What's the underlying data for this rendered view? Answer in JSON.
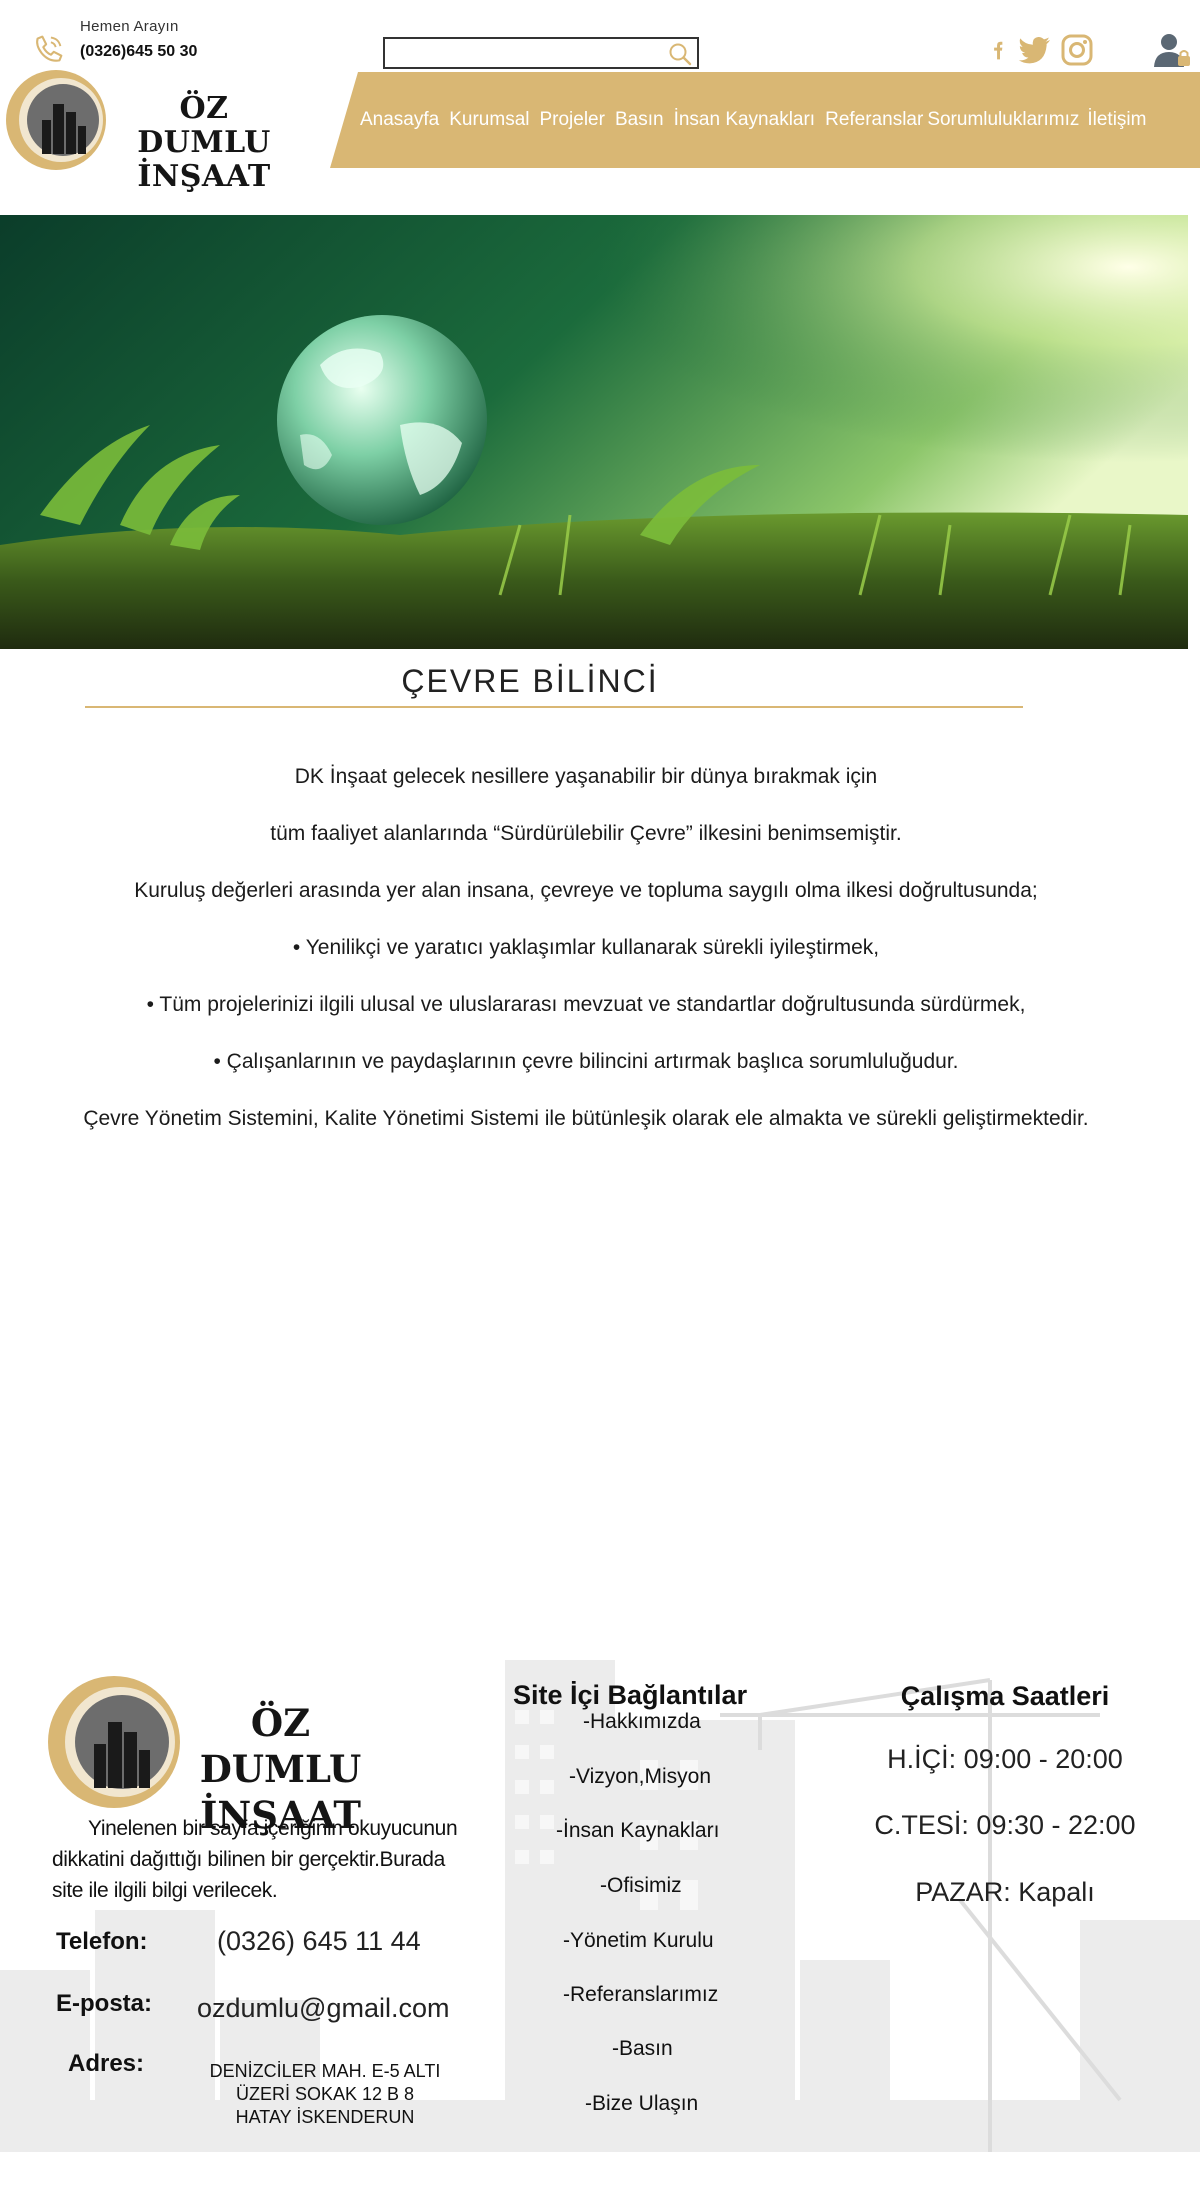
{
  "header": {
    "call_label": "Hemen Arayın",
    "call_number": "(0326)645 50 30",
    "search": {
      "placeholder": ""
    },
    "social_icons": [
      "facebook-icon",
      "twitter-icon",
      "instagram-icon"
    ],
    "user_icon": "user-icon",
    "logo": {
      "line1": "ÖZ DUMLU",
      "line2": "İNŞAAT"
    },
    "nav": [
      "Anasayfa",
      "Kurumsal",
      "Projeler",
      "Basın",
      "İnsan Kaynakları",
      "Referanslar",
      "Sorumluluklarımız",
      "İletişim"
    ]
  },
  "content": {
    "title": "ÇEVRE  BİLİNCİ",
    "paragraphs": [
      "DK İnşaat gelecek nesillere yaşanabilir bir dünya bırakmak için",
      "tüm faaliyet alanlarında “Sürdürülebilir Çevre” ilkesini benimsemiştir.",
      "Kuruluş değerleri arasında yer alan insana, çevreye ve topluma saygılı olma ilkesi doğrultusunda;",
      "• Yenilikçi ve yaratıcı yaklaşımlar kullanarak sürekli iyileştirmek,",
      "• Tüm projelerinizi ilgili ulusal ve uluslararası mevzuat ve standartlar doğrultusunda sürdürmek,",
      "• Çalışanlarının ve paydaşlarının çevre bilincini artırmak başlıca sorumluluğudur.",
      "Çevre Yönetim Sistemini, Kalite Yönetimi Sistemi ile bütünleşik olarak ele almakta ve sürekli geliştirmektedir."
    ]
  },
  "footer": {
    "logo": {
      "line1": "ÖZ DUMLU",
      "line2": "İNŞAAT"
    },
    "description": [
      "Yinelenen bir sayfa içeriğinin okuyucunun",
      "dikkatini dağıttığı bilinen bir gerçektir.Burada",
      "site ile ilgili  bilgi verilecek."
    ],
    "phone_label": "Telefon:",
    "phone": "(0326) 645 11 44",
    "email_label": "E-posta:",
    "email": "ozdumlu@gmail.com",
    "address_label": "Adres:",
    "address": [
      "DENİZCİLER MAH. E-5 ALTI",
      "ÜZERİ SOKAK 12 B 8",
      "HATAY İSKENDERUN"
    ],
    "links_title": "Site İçi Bağlantılar",
    "links": [
      "-Hakkımızda",
      "-Vizyon,Misyon",
      "-İnsan Kaynakları",
      "-Ofisimiz",
      "-Yönetim Kurulu",
      "-Referanslarımız",
      "-Basın",
      "-Bize Ulaşın"
    ],
    "hours_title": "Çalışma Saatleri",
    "hours": [
      "H.İÇİ: 09:00 - 20:00",
      "C.TESİ: 09:30 - 22:00",
      "PAZAR: Kapalı"
    ]
  },
  "colors": {
    "accent": "#d9b774",
    "text": "#1b1b1b",
    "background": "#ffffff"
  }
}
